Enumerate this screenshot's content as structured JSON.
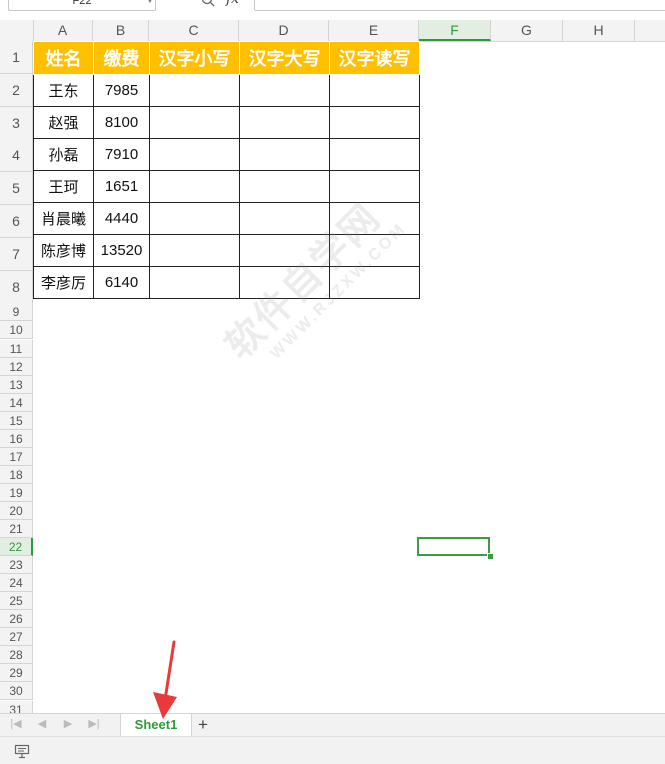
{
  "formula_bar": {
    "name_box": "F22",
    "fx": "fx",
    "value": ""
  },
  "columns": [
    "A",
    "B",
    "C",
    "D",
    "E",
    "F",
    "G",
    "H"
  ],
  "active_column": "F",
  "rows": [
    "1",
    "2",
    "3",
    "4",
    "5",
    "6",
    "7",
    "8",
    "9",
    "10",
    "11",
    "12",
    "13",
    "14",
    "15",
    "16",
    "17",
    "18",
    "19",
    "20",
    "21",
    "22",
    "23",
    "24",
    "25",
    "26",
    "27",
    "28",
    "29",
    "30",
    "31"
  ],
  "active_row": "22",
  "table": {
    "headers": [
      "姓名",
      "缴费",
      "汉字小写",
      "汉字大写",
      "汉字读写"
    ],
    "rows": [
      [
        "王东",
        "7985",
        "",
        "",
        ""
      ],
      [
        "赵强",
        "8100",
        "",
        "",
        ""
      ],
      [
        "孙磊",
        "7910",
        "",
        "",
        ""
      ],
      [
        "王珂",
        "1651",
        "",
        "",
        ""
      ],
      [
        "肖晨曦",
        "4440",
        "",
        "",
        ""
      ],
      [
        "陈彦博",
        "13520",
        "",
        "",
        ""
      ],
      [
        "李彦厉",
        "6140",
        "",
        "",
        ""
      ]
    ]
  },
  "watermark": {
    "main": "软件自学网",
    "sub": "WWW.RJZXW.COM"
  },
  "sheet_tabs": {
    "active": "Sheet1",
    "add": "+"
  },
  "colors": {
    "header_fill": "#ffc000",
    "active_green": "#2e9b3a",
    "arrow_red": "#e83a3a"
  },
  "icons": {
    "zoom": "magnifier-icon",
    "status": "macro-record-icon",
    "annotation": "red-arrow-icon"
  }
}
